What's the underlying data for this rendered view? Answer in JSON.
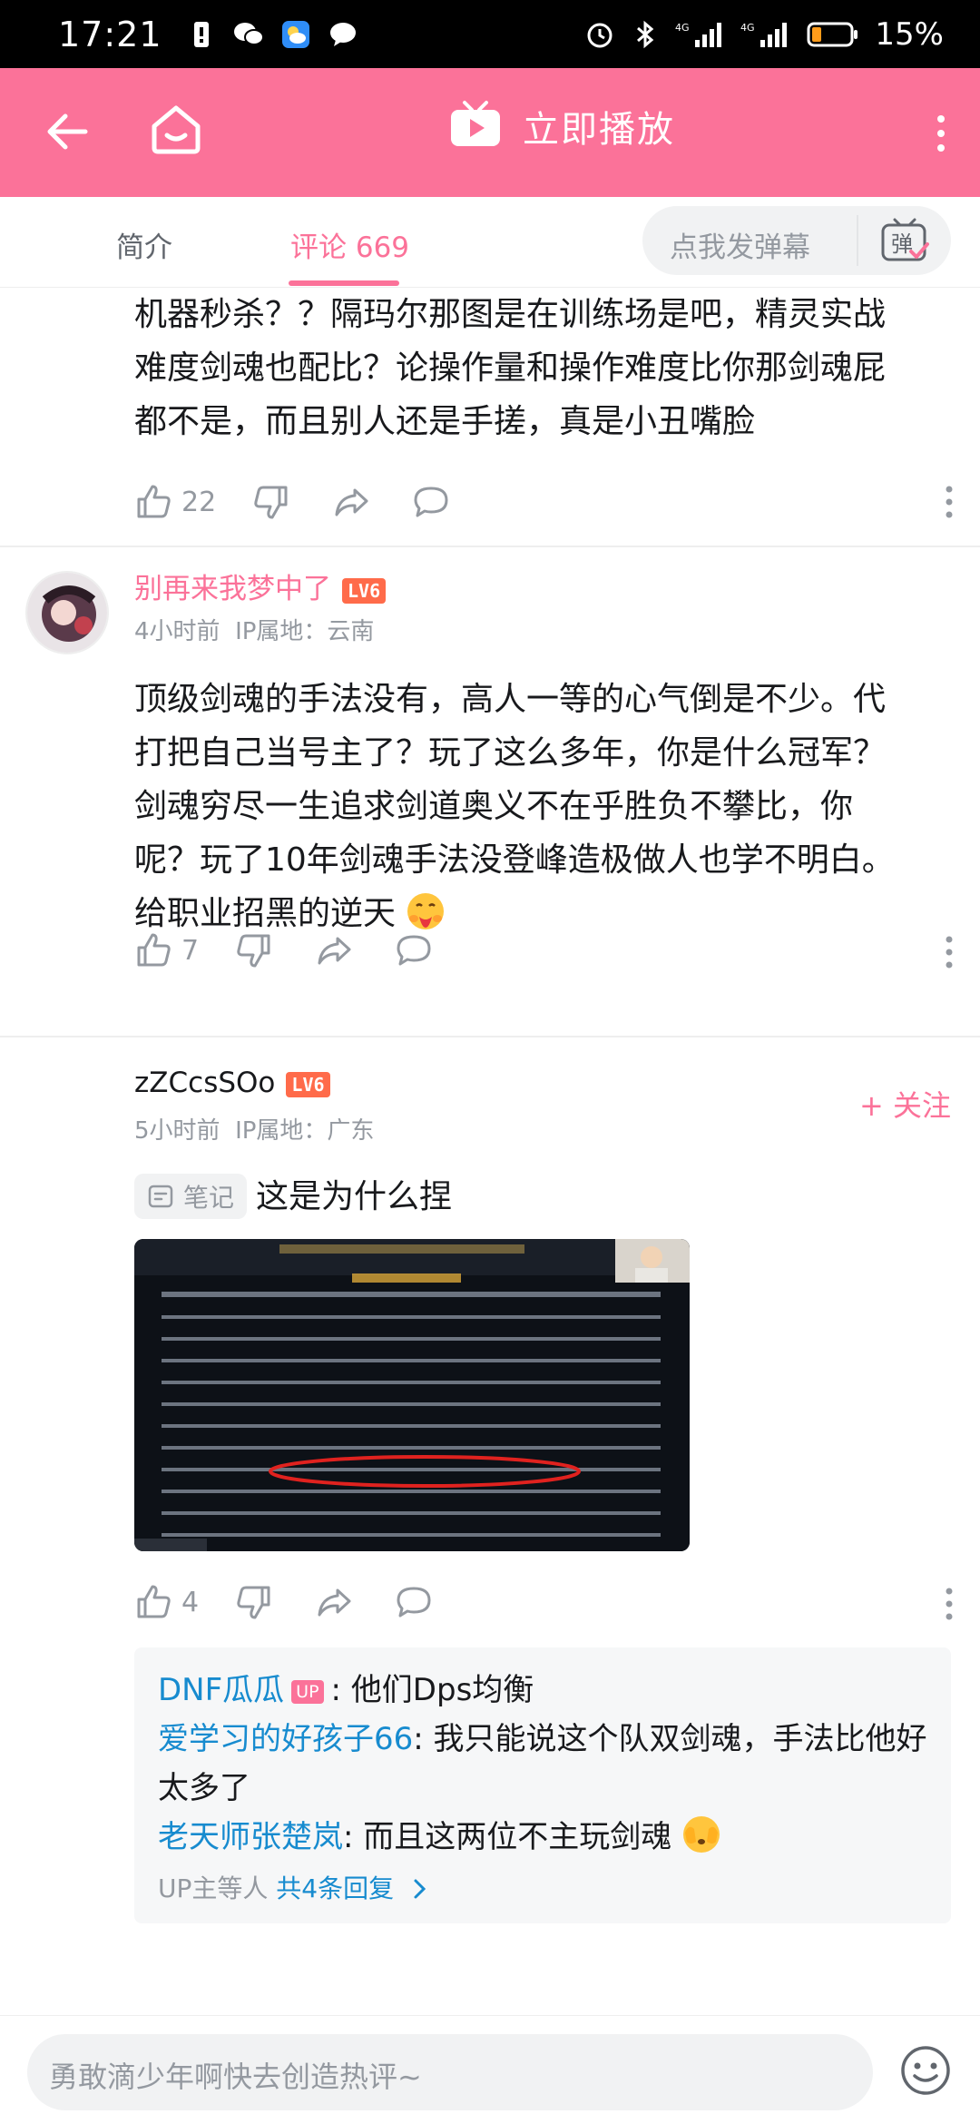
{
  "status_bar": {
    "time": "17:21",
    "battery": "15%",
    "signal_labels": [
      "4G",
      "4G"
    ]
  },
  "app_bar": {
    "play_title": "立即播放"
  },
  "tabs": {
    "intro": "简介",
    "comments": "评论 669",
    "danmaku_placeholder": "点我发弹幕",
    "danmaku_icon_text": "弹"
  },
  "comments": [
    {
      "text_lines": [
        "机器秒杀？？隔玛尔那图是在训练场是吧，精灵实战",
        "难度剑魂也配比？论操作量和操作难度比你那剑魂屁",
        "都不是，而且别人还是手搓，真是小丑嘴脸"
      ],
      "likes": "22"
    },
    {
      "username": "别再来我梦中了",
      "level": "LV6",
      "time": "4小时前",
      "ip": "IP属地：云南",
      "text_lines": [
        "顶级剑魂的手法没有，高人一等的心气倒是不少。代",
        "打把自己当号主了？玩了这么多年，你是什么冠军？",
        "剑魂穷尽一生追求剑道奥义不在乎胜负不攀比，你",
        "呢？玩了10年剑魂手法没登峰造极做人也学不明白。",
        "给职业招黑的逆天"
      ],
      "likes": "7"
    },
    {
      "username": "zZCcsSOo",
      "level": "LV6",
      "time": "5小时前",
      "ip": "IP属地：广东",
      "follow": "+ 关注",
      "note_tag": "笔记",
      "text": "这是为什么捏",
      "likes": "4",
      "replies": [
        {
          "user": "DNF瓜瓜",
          "is_up": true,
          "up_label": "UP",
          "text": "他们Dps均衡"
        },
        {
          "user": "爱学习的好孩子66",
          "is_up": false,
          "text": "我只能说这个队双剑魂，手法比他好太多了"
        },
        {
          "user": "老天师张楚岚",
          "is_up": false,
          "text": "而且这两位不主玩剑魂"
        }
      ],
      "reply_footer_prefix": "UP主等人 ",
      "reply_footer_link": "共4条回复"
    }
  ],
  "bottom": {
    "input_placeholder": "勇敢滴少年啊快去创造热评~"
  },
  "colors": {
    "brand_pink": "#fb7299",
    "link_blue": "#178bcf",
    "muted": "#9499a0",
    "level_red": "#ff6b4a"
  }
}
